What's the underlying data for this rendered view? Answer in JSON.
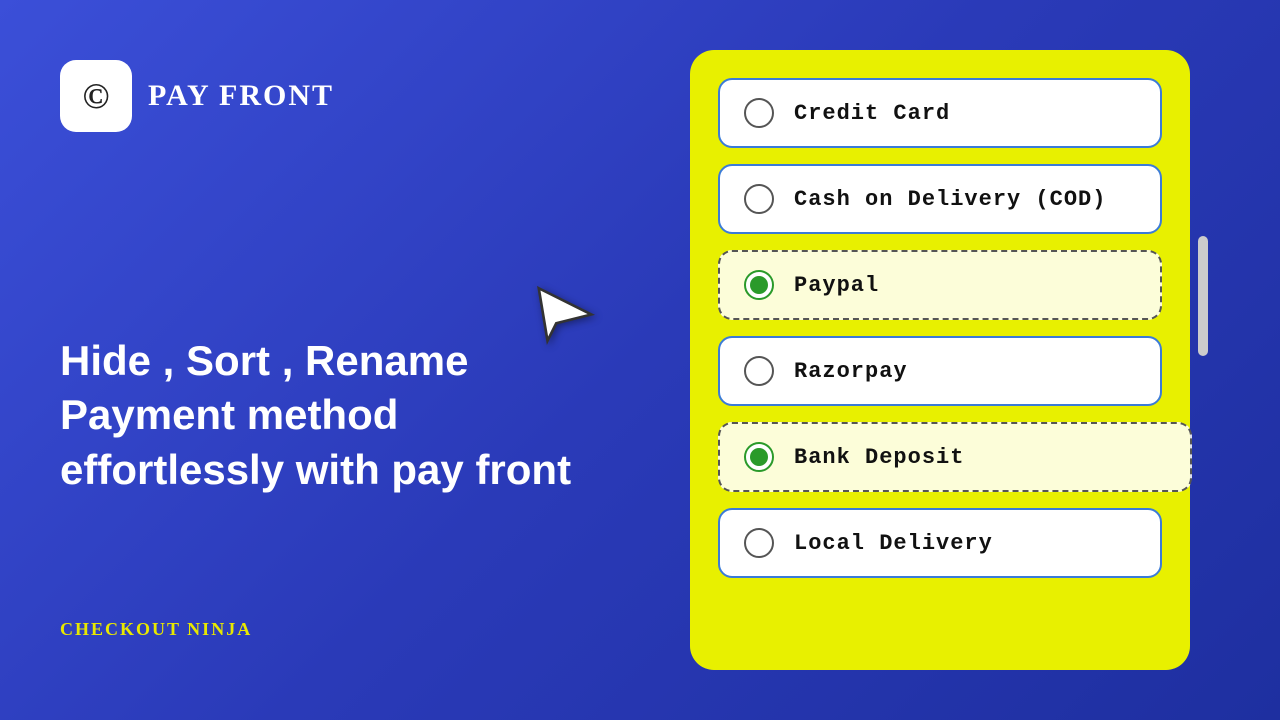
{
  "logo": {
    "icon": "©",
    "name": "PAY FRONT"
  },
  "tagline": "Hide , Sort , Rename Payment method effortlessly with pay front",
  "brand": {
    "checkout_ninja": "CHECKOUT NINJA"
  },
  "payment_methods": [
    {
      "id": "credit-card",
      "label": "Credit Card",
      "selected": false,
      "dashed": false
    },
    {
      "id": "cod",
      "label": "Cash on Delivery (COD)",
      "selected": false,
      "dashed": false
    },
    {
      "id": "paypal",
      "label": "Paypal",
      "selected": true,
      "dashed": true
    },
    {
      "id": "razorpay",
      "label": "Razorpay",
      "selected": false,
      "dashed": false
    },
    {
      "id": "bank-deposit",
      "label": "Bank Deposit",
      "selected": true,
      "dashed": true
    },
    {
      "id": "local-delivery",
      "label": "Local Delivery",
      "selected": false,
      "dashed": false
    }
  ],
  "colors": {
    "background_start": "#3b4fd8",
    "background_end": "#1e2fa0",
    "yellow": "#e8f000",
    "accent_blue": "#3b7bd8",
    "green": "#2a9a2a",
    "text_white": "#ffffff",
    "brand_yellow": "#e8e800"
  }
}
